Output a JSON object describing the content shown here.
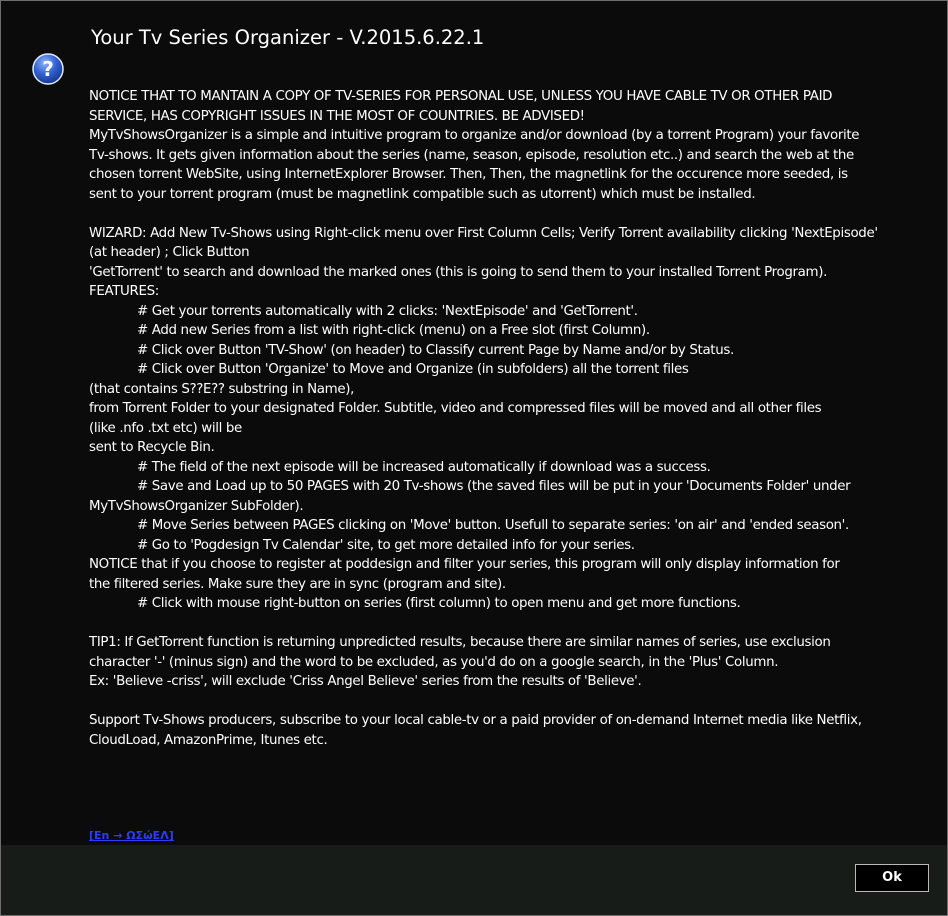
{
  "dialog": {
    "title": "Your Tv Series Organizer - V.2015.6.22.1",
    "icon": "question-mark-icon",
    "body_lines": [
      {
        "text": "NOTICE THAT TO MANTAIN A COPY OF TV-SERIES FOR PERSONAL USE, UNLESS YOU HAVE CABLE TV OR OTHER PAID",
        "indent": false
      },
      {
        "text": "SERVICE, HAS COPYRIGHT ISSUES IN THE MOST OF COUNTRIES. BE ADVISED!",
        "indent": false
      },
      {
        "text": "MyTvShowsOrganizer is a simple and intuitive program to organize and/or download (by a torrent Program) your favorite",
        "indent": false
      },
      {
        "text": "Tv-shows. It gets given information about the series (name, season, episode, resolution etc..) and search the web at the",
        "indent": false
      },
      {
        "text": "chosen torrent WebSite, using InternetExplorer Browser. Then, Then, the magnetlink for the occurence more seeded, is",
        "indent": false
      },
      {
        "text": "sent to your torrent program (must be magnetlink compatible such as utorrent) which must be installed.",
        "indent": false
      },
      {
        "text": "",
        "indent": false
      },
      {
        "text": "WIZARD: Add New Tv-Shows using Right-click menu over First Column Cells; Verify Torrent availability clicking 'NextEpisode'",
        "indent": false
      },
      {
        "text": "(at header) ; Click Button",
        "indent": false
      },
      {
        "text": "'GetTorrent' to search and download the marked ones (this is going to send them to your installed Torrent Program).",
        "indent": false
      },
      {
        "text": "FEATURES:",
        "indent": false
      },
      {
        "text": "# Get your torrents automatically with 2 clicks: 'NextEpisode' and 'GetTorrent'.",
        "indent": true
      },
      {
        "text": "# Add new Series from a list with right-click (menu) on a Free slot (first Column).",
        "indent": true
      },
      {
        "text": "# Click over Button 'TV-Show' (on header) to Classify current Page by Name and/or by Status.",
        "indent": true
      },
      {
        "text": "# Click over Button 'Organize' to Move and Organize (in subfolders) all the torrent files",
        "indent": true
      },
      {
        "text": "(that contains S??E?? substring in Name),",
        "indent": false
      },
      {
        "text": "from Torrent Folder to your designated Folder. Subtitle, video and compressed files will be moved and all other files",
        "indent": false
      },
      {
        "text": "(like .nfo .txt etc) will be",
        "indent": false
      },
      {
        "text": "sent to Recycle Bin.",
        "indent": false
      },
      {
        "text": "# The field of the next episode will be increased  automatically if download was a success.",
        "indent": true
      },
      {
        "text": "# Save and Load up to 50 PAGES with 20 Tv-shows (the saved files will be put in your 'Documents Folder' under",
        "indent": true
      },
      {
        "text": "MyTvShowsOrganizer SubFolder).",
        "indent": false
      },
      {
        "text": "# Move Series between PAGES clicking on 'Move' button. Usefull to separate series: 'on air' and 'ended season'.",
        "indent": true
      },
      {
        "text": "# Go to 'Pogdesign Tv Calendar' site, to get more detailed info for your series.",
        "indent": true
      },
      {
        "text": "NOTICE that if you choose to register at poddesign and filter your series, this program will only display information for",
        "indent": false
      },
      {
        "text": "the filtered series. Make sure they are in sync (program and site).",
        "indent": false
      },
      {
        "text": "# Click with mouse right-button on series (first column) to open menu and get more functions.",
        "indent": true
      },
      {
        "text": "",
        "indent": false
      },
      {
        "text": "TIP1: If GetTorrent function is returning unpredicted results, because there are similar names of series, use exclusion",
        "indent": false
      },
      {
        "text": "character '-' (minus sign) and the word to be excluded, as you'd do on a google search, in the 'Plus' Column.",
        "indent": false
      },
      {
        "text": "Ex: 'Believe -criss', will exclude 'Criss Angel Believe' series from the results of 'Believe'.",
        "indent": false
      },
      {
        "text": "",
        "indent": false
      },
      {
        "text": "Support Tv-Shows producers, subscribe to your local cable-tv or a paid provider of on-demand Internet media like Netflix,",
        "indent": false
      },
      {
        "text": "CloudLoad, AmazonPrime, Itunes etc.",
        "indent": false
      }
    ],
    "language_link": "[En → ΩΣώΕΛ]",
    "ok_label": "Ok"
  },
  "colors": {
    "background": "#0b0b0b",
    "footer": "#181c18",
    "text": "#ffffff",
    "link": "#2a3cff",
    "icon_blue": "#2f5fd0"
  }
}
